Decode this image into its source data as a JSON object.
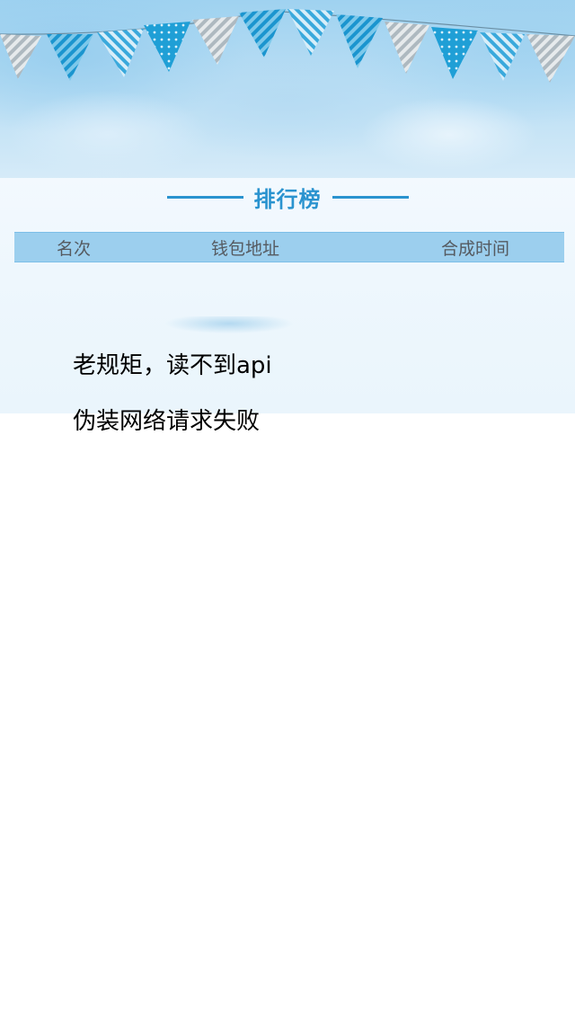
{
  "header": {
    "title": "排行榜"
  },
  "table": {
    "columns": [
      "名次",
      "钱包地址",
      "合成时间"
    ],
    "rows": []
  },
  "notes": [
    "老规矩，读不到api",
    "伪装网络请求失败"
  ],
  "colors": {
    "accent": "#2a93cf",
    "table_header_bg": "#9ccfee",
    "sky": "#9fd2f0",
    "flag_blue": "#29a3d6",
    "flag_grey": "#b9c2c8"
  }
}
